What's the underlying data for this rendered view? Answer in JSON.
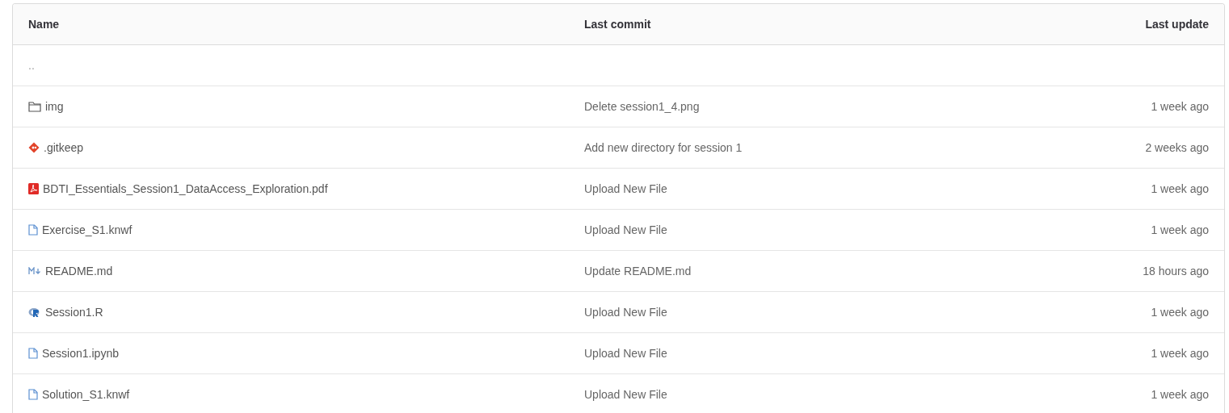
{
  "table": {
    "columns": [
      "Name",
      "Last commit",
      "Last update"
    ],
    "rows": [
      {
        "kind": "parent",
        "name": "..",
        "last_commit": "",
        "last_update": ""
      },
      {
        "kind": "folder",
        "name": "img",
        "last_commit": "Delete session1_4.png",
        "last_update": "1 week ago"
      },
      {
        "kind": "git",
        "name": ".gitkeep",
        "last_commit": "Add new directory for session 1",
        "last_update": "2 weeks ago"
      },
      {
        "kind": "pdf",
        "name": "BDTI_Essentials_Session1_DataAccess_Exploration.pdf",
        "last_commit": "Upload New File",
        "last_update": "1 week ago"
      },
      {
        "kind": "file",
        "name": "Exercise_S1.knwf",
        "last_commit": "Upload New File",
        "last_update": "1 week ago"
      },
      {
        "kind": "markdown",
        "name": "README.md",
        "last_commit": "Update README.md",
        "last_update": "18 hours ago"
      },
      {
        "kind": "r",
        "name": "Session1.R",
        "last_commit": "Upload New File",
        "last_update": "1 week ago"
      },
      {
        "kind": "file",
        "name": "Session1.ipynb",
        "last_commit": "Upload New File",
        "last_update": "1 week ago"
      },
      {
        "kind": "file",
        "name": "Solution_S1.knwf",
        "last_commit": "Upload New File",
        "last_update": "1 week ago"
      }
    ]
  }
}
